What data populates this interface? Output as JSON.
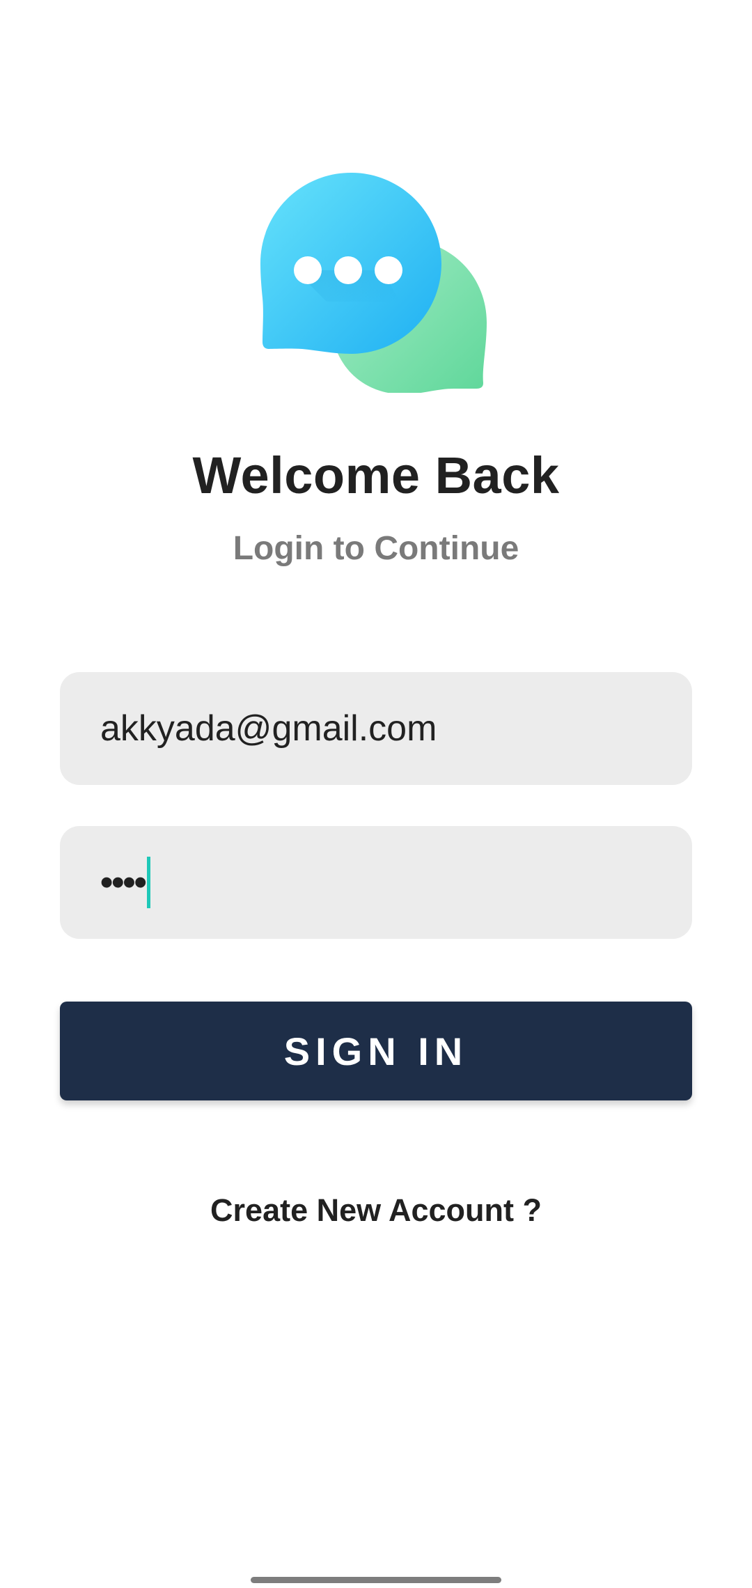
{
  "header": {
    "logo_icon": "chat-bubbles-icon",
    "title": "Welcome Back",
    "subtitle": "Login to Continue"
  },
  "form": {
    "email": {
      "value": "akkyada@gmail.com",
      "placeholder": ""
    },
    "password": {
      "masked_value": "••••",
      "placeholder": ""
    },
    "signin_label": "SIGN IN",
    "create_account_label": "Create New Account ?"
  },
  "colors": {
    "primary_button": "#1e2e48",
    "input_background": "#ececec",
    "caret": "#1ec8b8",
    "bubble_blue": "#3ec9f5",
    "bubble_green": "#7fe0b0"
  }
}
